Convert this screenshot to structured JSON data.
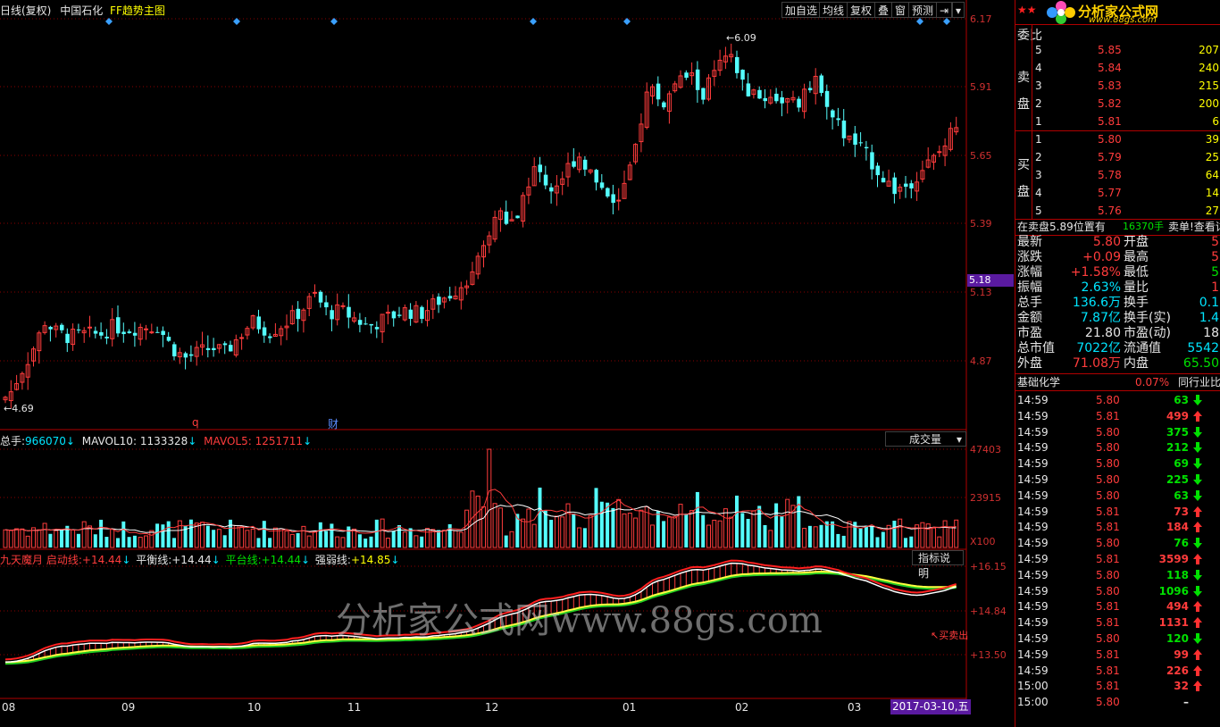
{
  "colors": {
    "up": "#ff3c3c",
    "down": "#54fcfc",
    "grid": "#8a0000",
    "accent": "#c00000"
  },
  "header": {
    "period": "日线(复权)",
    "stock": "中国石化",
    "indicator": "FF趋势主图",
    "toolbar": [
      "加自选",
      "均线",
      "复权",
      "叠",
      "窗",
      "预测",
      "⇥",
      "▾"
    ]
  },
  "price_axis": [
    "6.17",
    "5.91",
    "5.65",
    "5.39",
    "5.13",
    "4.87"
  ],
  "current_price_tag": "5.18",
  "annotations": {
    "high": "6.09",
    "low": "4.69",
    "mark_q": "q",
    "mark_cai": "财"
  },
  "volume_header": {
    "total_label": "总手:",
    "total_value": "966070",
    "mavol10_label": "MAVOL10:",
    "mavol10_value": "1133328",
    "mavol5_label": "MAVOL5:",
    "mavol5_value": "1251711",
    "dropdown": "成交量",
    "axis": [
      "47403",
      "23915"
    ],
    "unit": "X100"
  },
  "indicator_header": {
    "name": "九天魔月",
    "start_label": "启动线:",
    "start_value": "+14.44",
    "balance_label": "平衡线:",
    "balance_value": "+14.44",
    "platform_label": "平台线:",
    "platform_value": "+14.44",
    "strength_label": "强弱线:",
    "strength_value": "+14.85",
    "help_button": "指标说明",
    "axis": [
      "+16.15",
      "+14.84",
      "+13.50"
    ],
    "buy_sell_label": "买卖出"
  },
  "date_axis": [
    "08",
    "09",
    "10",
    "11",
    "12",
    "01",
    "02",
    "03"
  ],
  "current_date": "2017-03-10,五",
  "watermark": "分析家公式网www.88gs.com",
  "logo": {
    "stars": "★★",
    "name": "分析家公式网",
    "url": "www.88gs.com"
  },
  "order_book": {
    "head_label": "委比",
    "sell_label": "卖盘",
    "buy_label": "买盘",
    "asks": [
      {
        "level": "5",
        "price": "5.85",
        "vol": "207"
      },
      {
        "level": "4",
        "price": "5.84",
        "vol": "240"
      },
      {
        "level": "3",
        "price": "5.83",
        "vol": "215"
      },
      {
        "level": "2",
        "price": "5.82",
        "vol": "200"
      },
      {
        "level": "1",
        "price": "5.81",
        "vol": "6"
      }
    ],
    "bids": [
      {
        "level": "1",
        "price": "5.80",
        "vol": "39"
      },
      {
        "level": "2",
        "price": "5.79",
        "vol": "25"
      },
      {
        "level": "3",
        "price": "5.78",
        "vol": "64"
      },
      {
        "level": "4",
        "price": "5.77",
        "vol": "14"
      },
      {
        "level": "5",
        "price": "5.76",
        "vol": "27"
      }
    ],
    "notice_a": "在卖盘5.89位置有",
    "notice_b": "16370手",
    "notice_c": "卖单!查看详"
  },
  "quote": [
    {
      "l1": "最新",
      "v1": "5.80",
      "c1": "red",
      "l2": "开盘",
      "v2": "5",
      "c2": "red"
    },
    {
      "l1": "涨跌",
      "v1": "+0.09",
      "c1": "red",
      "l2": "最高",
      "v2": "5",
      "c2": "red"
    },
    {
      "l1": "涨幅",
      "v1": "+1.58%",
      "c1": "red",
      "l2": "最低",
      "v2": "5",
      "c2": "grn"
    },
    {
      "l1": "振幅",
      "v1": "2.63%",
      "c1": "cyn",
      "l2": "量比",
      "v2": "1",
      "c2": "red"
    },
    {
      "l1": "总手",
      "v1": "136.6万",
      "c1": "cyn",
      "l2": "换手",
      "v2": "0.1",
      "c2": "cyn"
    },
    {
      "l1": "金额",
      "v1": "7.87亿",
      "c1": "cyn",
      "l2": "换手(实)",
      "v2": "1.4",
      "c2": "cyn"
    },
    {
      "l1": "市盈",
      "v1": "21.80",
      "c1": "wht",
      "l2": "市盈(动)",
      "v2": "18",
      "c2": "wht"
    },
    {
      "l1": "总市值",
      "v1": "7022亿",
      "c1": "cyn",
      "l2": "流通值",
      "v2": "5542",
      "c2": "cyn"
    },
    {
      "l1": "外盘",
      "v1": "71.08万",
      "c1": "red",
      "l2": "内盘",
      "v2": "65.50",
      "c2": "grn"
    }
  ],
  "sector": {
    "name": "基础化学",
    "change": "0.07%",
    "compare": "同行业比较"
  },
  "trades": [
    {
      "t": "14:59",
      "p": "5.80",
      "pc": "red",
      "v": "63",
      "d": "dn"
    },
    {
      "t": "14:59",
      "p": "5.81",
      "pc": "red",
      "v": "499",
      "d": "up"
    },
    {
      "t": "14:59",
      "p": "5.80",
      "pc": "red",
      "v": "375",
      "d": "dn"
    },
    {
      "t": "14:59",
      "p": "5.80",
      "pc": "red",
      "v": "212",
      "d": "dn"
    },
    {
      "t": "14:59",
      "p": "5.80",
      "pc": "red",
      "v": "69",
      "d": "dn"
    },
    {
      "t": "14:59",
      "p": "5.80",
      "pc": "red",
      "v": "225",
      "d": "dn"
    },
    {
      "t": "14:59",
      "p": "5.80",
      "pc": "red",
      "v": "63",
      "d": "dn"
    },
    {
      "t": "14:59",
      "p": "5.81",
      "pc": "red",
      "v": "73",
      "d": "up"
    },
    {
      "t": "14:59",
      "p": "5.81",
      "pc": "red",
      "v": "184",
      "d": "up"
    },
    {
      "t": "14:59",
      "p": "5.80",
      "pc": "red",
      "v": "76",
      "d": "dn"
    },
    {
      "t": "14:59",
      "p": "5.81",
      "pc": "red",
      "v": "3599",
      "d": "up"
    },
    {
      "t": "14:59",
      "p": "5.80",
      "pc": "red",
      "v": "118",
      "d": "dn"
    },
    {
      "t": "14:59",
      "p": "5.80",
      "pc": "red",
      "v": "1096",
      "d": "dn"
    },
    {
      "t": "14:59",
      "p": "5.81",
      "pc": "red",
      "v": "494",
      "d": "up"
    },
    {
      "t": "14:59",
      "p": "5.81",
      "pc": "red",
      "v": "1131",
      "d": "up"
    },
    {
      "t": "14:59",
      "p": "5.80",
      "pc": "red",
      "v": "120",
      "d": "dn"
    },
    {
      "t": "14:59",
      "p": "5.81",
      "pc": "red",
      "v": "99",
      "d": "up"
    },
    {
      "t": "14:59",
      "p": "5.81",
      "pc": "red",
      "v": "226",
      "d": "up"
    },
    {
      "t": "15:00",
      "p": "5.81",
      "pc": "red",
      "v": "32",
      "d": "up"
    },
    {
      "t": "15:00",
      "p": "5.80",
      "pc": "red",
      "v": "–",
      "d": "none"
    }
  ]
}
